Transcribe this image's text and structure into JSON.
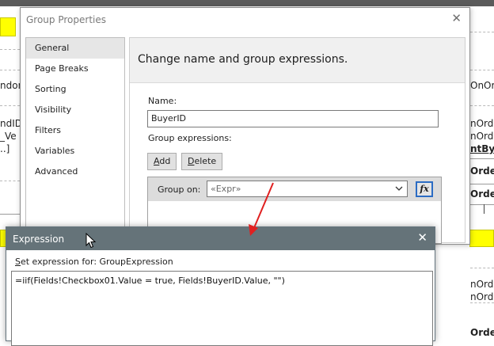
{
  "background": {
    "left_fragments": [
      "ndon",
      "ndID",
      "_Ve",
      "..]"
    ],
    "right_fragments": [
      "OnOrd",
      "nOrde",
      "nOrde",
      "ntBy",
      "Orde",
      "Orde",
      "nOrde",
      "nOrde",
      "Orde"
    ]
  },
  "group_properties": {
    "title": "Group Properties",
    "close_glyph": "✕",
    "nav_items": [
      {
        "label": "General"
      },
      {
        "label": "Page Breaks"
      },
      {
        "label": "Sorting"
      },
      {
        "label": "Visibility"
      },
      {
        "label": "Filters"
      },
      {
        "label": "Variables"
      },
      {
        "label": "Advanced"
      }
    ],
    "header_text": "Change name and group expressions.",
    "name_label": "Name:",
    "name_value": "BuyerID",
    "group_expressions_label": "Group expressions:",
    "add_button": {
      "accel": "A",
      "rest": "dd"
    },
    "delete_button": {
      "accel": "D",
      "rest": "elete"
    },
    "group_on_label": "Group on:",
    "group_on_value": "«Expr»",
    "fx_label": "fx"
  },
  "expression_dialog": {
    "title": "Expression",
    "close_glyph": "✕",
    "label_accel": "S",
    "label_rest": "et expression for: GroupExpression",
    "expression_text": "=iif(Fields!Checkbox01.Value = true, Fields!BuyerID.Value, \"\")"
  },
  "colors": {
    "highlight_yellow": "#ffff00",
    "expression_titlebar": "#657379",
    "annotation_arrow": "#e02020",
    "fx_border": "#2b6cc4"
  }
}
